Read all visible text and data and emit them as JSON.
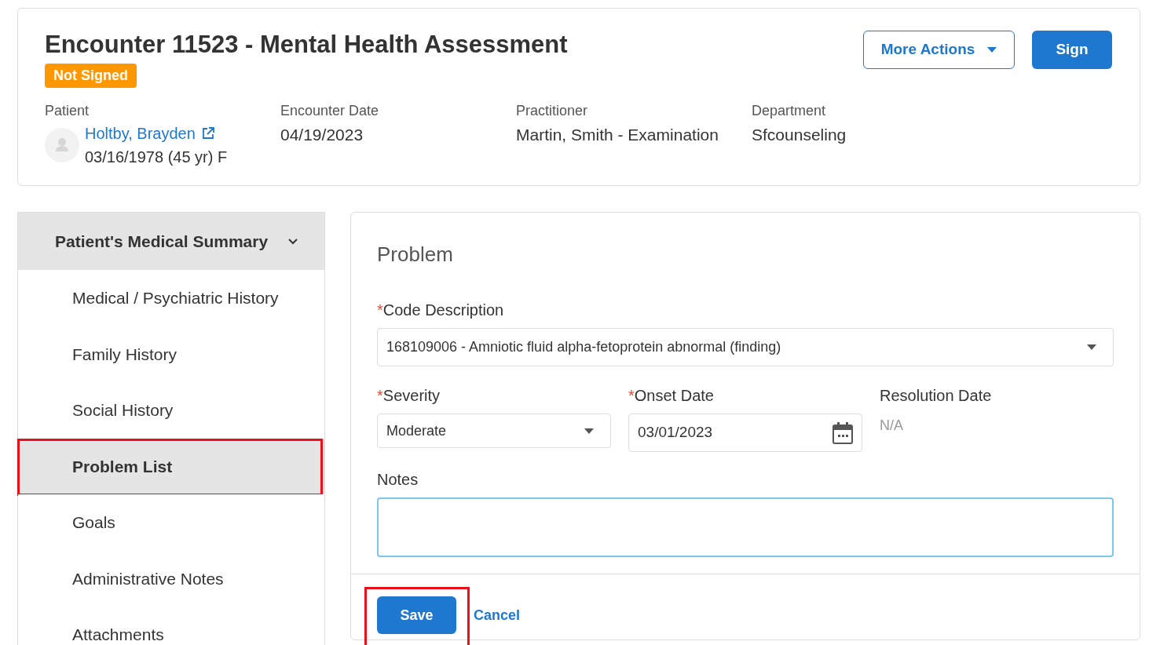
{
  "encounter": {
    "title": "Encounter 11523 - Mental Health Assessment",
    "status": "Not Signed",
    "actions": [
      {
        "label": "More Actions",
        "kind": "dropdown"
      },
      {
        "label": "Sign",
        "kind": "primary"
      }
    ],
    "patient": {
      "label": "Patient",
      "name": "Holtby, Brayden",
      "details": "03/16/1978 (45 yr) F"
    },
    "fields": [
      {
        "label": "Encounter Date",
        "value": "04/19/2023"
      },
      {
        "label": "Practitioner",
        "value": "Martin, Smith - Examination"
      },
      {
        "label": "Department",
        "value": "Sfcounseling"
      }
    ]
  },
  "sidebar": {
    "header": "Patient's Medical Summary",
    "expanded": true,
    "items": [
      {
        "label": "Medical / Psychiatric History",
        "selected": false,
        "highlighted": false
      },
      {
        "label": "Family History",
        "selected": false,
        "highlighted": false
      },
      {
        "label": "Social History",
        "selected": false,
        "highlighted": false
      },
      {
        "label": "Problem List",
        "selected": true,
        "highlighted": true
      },
      {
        "label": "Goals",
        "selected": false,
        "highlighted": false
      },
      {
        "label": "Administrative Notes",
        "selected": false,
        "highlighted": false
      },
      {
        "label": "Attachments",
        "selected": false,
        "highlighted": false
      }
    ]
  },
  "form": {
    "title": "Problem",
    "required_mark": "*",
    "code": {
      "label": "Code Description",
      "required": true,
      "value": "168109006 - Amniotic fluid alpha-fetoprotein abnormal (finding)"
    },
    "severity": {
      "label": "Severity",
      "required": true,
      "value": "Moderate"
    },
    "onset": {
      "label": "Onset Date",
      "required": true,
      "value": "03/01/2023"
    },
    "resolution": {
      "label": "Resolution Date",
      "required": false,
      "value": "N/A"
    },
    "notes": {
      "label": "Notes",
      "focused": true
    },
    "save": {
      "label": "Save",
      "highlighted": true
    },
    "cancel": {
      "label": "Cancel"
    }
  }
}
